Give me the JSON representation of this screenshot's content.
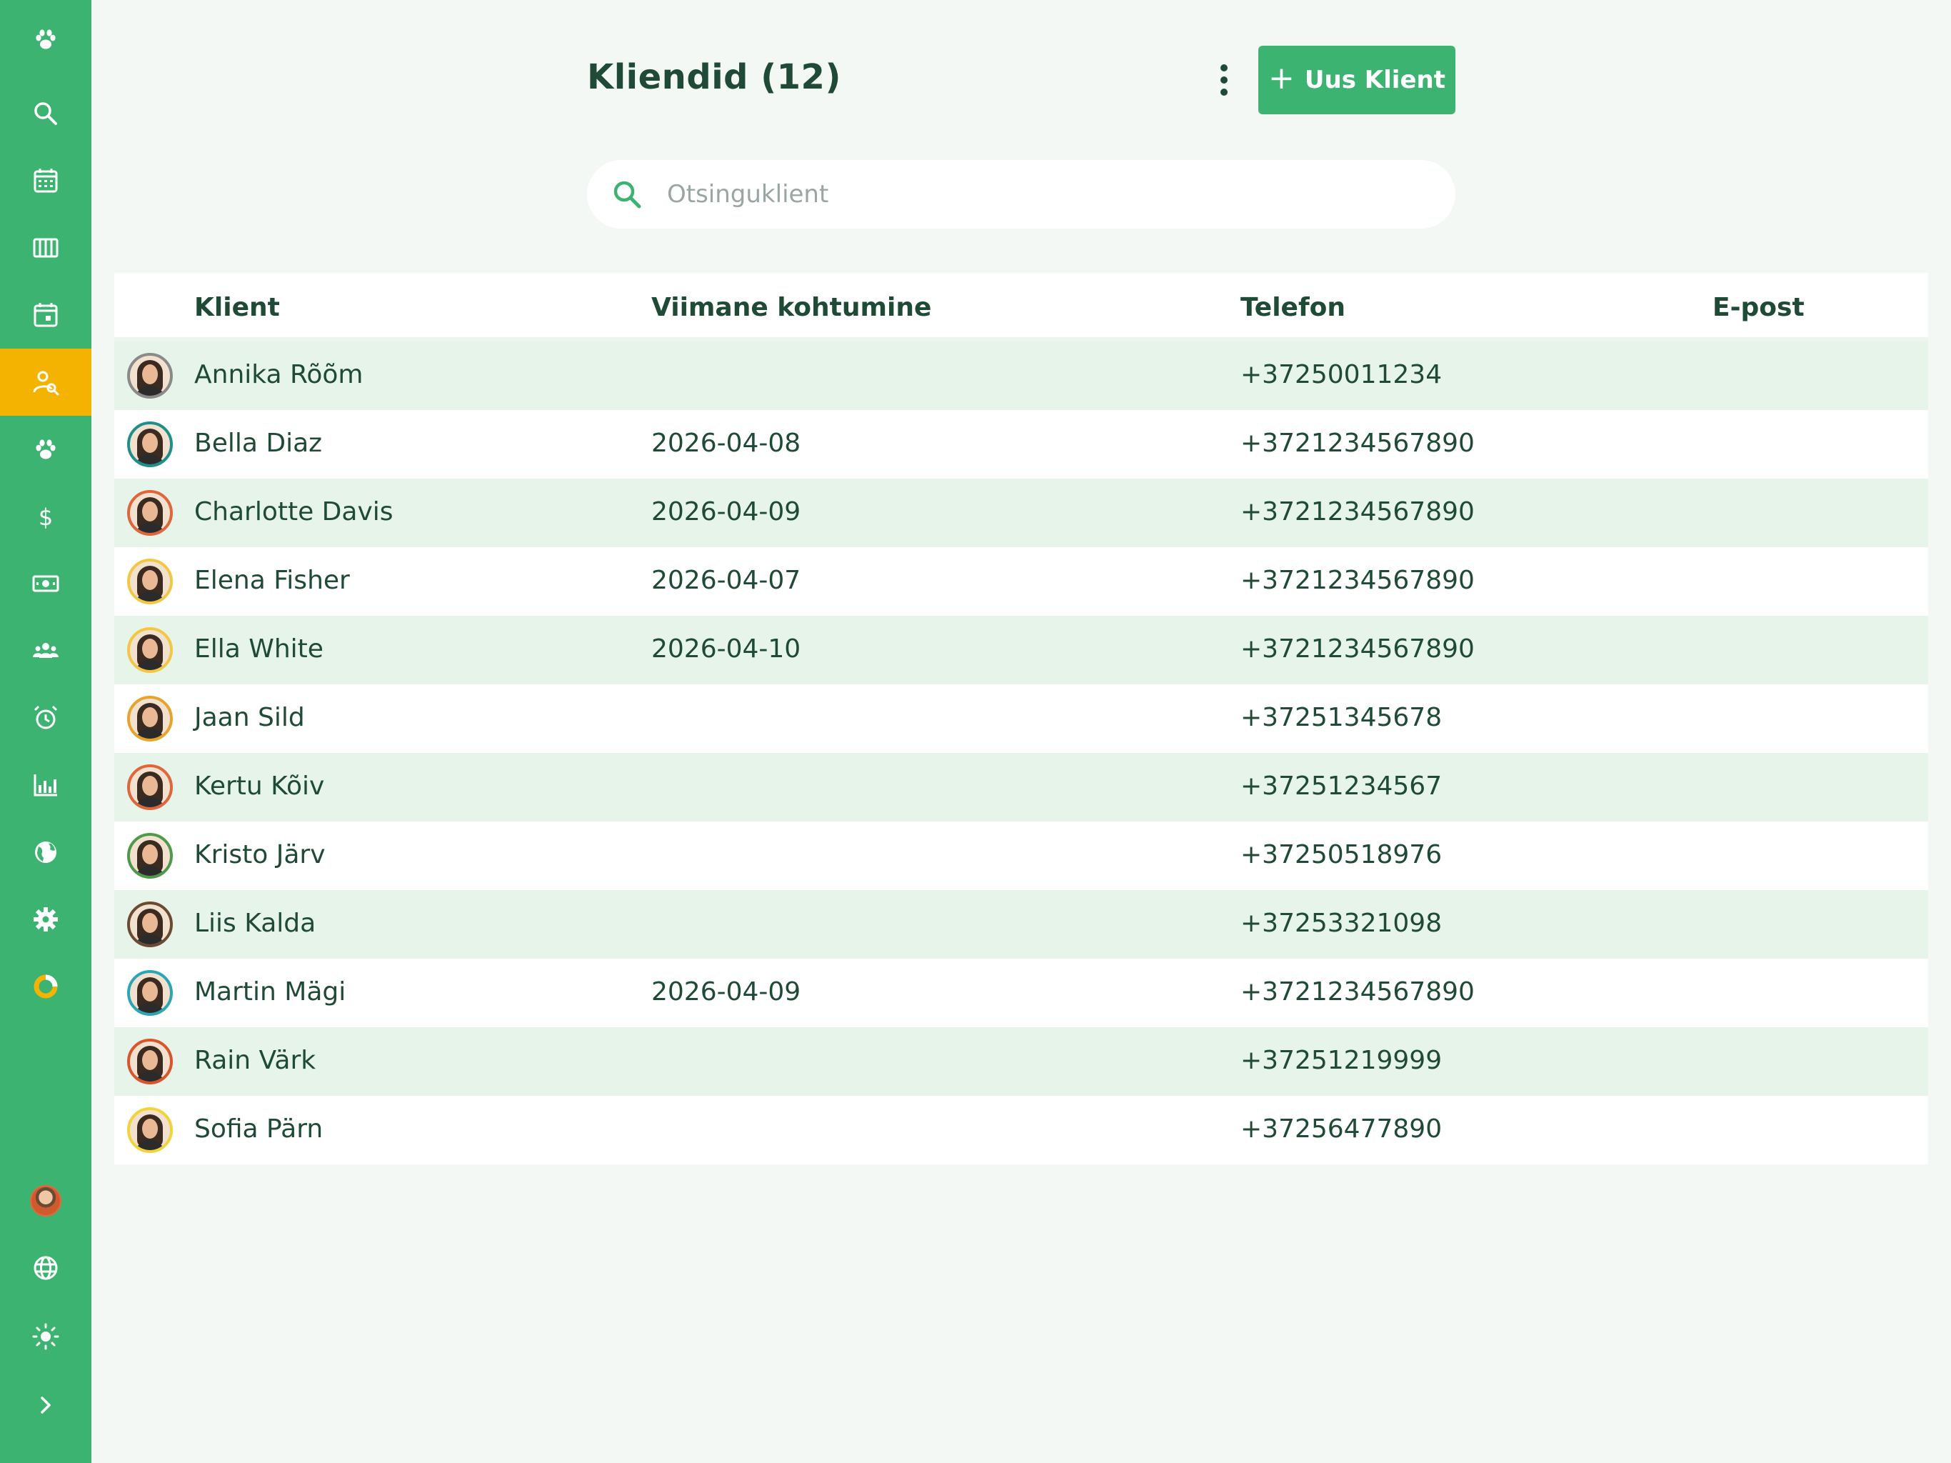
{
  "sidebar": {
    "items": [
      {
        "name": "paw-logo",
        "icon": "paw-icon"
      },
      {
        "name": "search",
        "icon": "search-icon"
      },
      {
        "name": "calendar",
        "icon": "calendar-grid-icon"
      },
      {
        "name": "columns",
        "icon": "columns-icon"
      },
      {
        "name": "calendar-event",
        "icon": "calendar-event-icon"
      },
      {
        "name": "clients",
        "icon": "user-search-icon",
        "active": true
      },
      {
        "name": "pets",
        "icon": "paw-icon"
      },
      {
        "name": "payments",
        "icon": "dollar-icon"
      },
      {
        "name": "cash",
        "icon": "cash-icon"
      },
      {
        "name": "team",
        "icon": "users-icon"
      },
      {
        "name": "reminders",
        "icon": "alarm-icon"
      },
      {
        "name": "reports",
        "icon": "bar-chart-icon"
      },
      {
        "name": "web",
        "icon": "globe-icon"
      },
      {
        "name": "settings",
        "icon": "gear-icon"
      },
      {
        "name": "status",
        "icon": "donut-icon"
      }
    ],
    "bottom": [
      {
        "name": "user-avatar",
        "icon": "avatar"
      },
      {
        "name": "language",
        "icon": "globe-outline-icon"
      },
      {
        "name": "theme",
        "icon": "sun-icon"
      },
      {
        "name": "expand",
        "icon": "chevron-right-icon"
      }
    ]
  },
  "header": {
    "title": "Kliendid (12)",
    "new_button_label": "Uus Klient",
    "new_button_icon": "+"
  },
  "search": {
    "placeholder": "Otsinguklient",
    "value": ""
  },
  "table": {
    "columns": [
      "Klient",
      "Viimane kohtumine",
      "Telefon",
      "E-post"
    ],
    "rows": [
      {
        "name": "Annika Rõõm",
        "last_meeting": "",
        "phone": "+37250011234",
        "email": "",
        "ring": "#8a8a8a"
      },
      {
        "name": "Bella Diaz",
        "last_meeting": "2026-04-08",
        "phone": "+3721234567890",
        "email": "",
        "ring": "#1f8f8a"
      },
      {
        "name": "Charlotte Davis",
        "last_meeting": "2026-04-09",
        "phone": "+3721234567890",
        "email": "",
        "ring": "#e0653a"
      },
      {
        "name": "Elena Fisher",
        "last_meeting": "2026-04-07",
        "phone": "+3721234567890",
        "email": "",
        "ring": "#f2c744"
      },
      {
        "name": "Ella White",
        "last_meeting": "2026-04-10",
        "phone": "+3721234567890",
        "email": "",
        "ring": "#f2c744"
      },
      {
        "name": "Jaan Sild",
        "last_meeting": "",
        "phone": "+37251345678",
        "email": "",
        "ring": "#e8a32a"
      },
      {
        "name": "Kertu Kõiv",
        "last_meeting": "",
        "phone": "+37251234567",
        "email": "",
        "ring": "#e0653a"
      },
      {
        "name": "Kristo Järv",
        "last_meeting": "",
        "phone": "+37250518976",
        "email": "",
        "ring": "#4f9a4a"
      },
      {
        "name": "Liis Kalda",
        "last_meeting": "",
        "phone": "+37253321098",
        "email": "",
        "ring": "#6b4a33"
      },
      {
        "name": "Martin Mägi",
        "last_meeting": "2026-04-09",
        "phone": "+3721234567890",
        "email": "",
        "ring": "#2aa7b3"
      },
      {
        "name": "Rain Värk",
        "last_meeting": "",
        "phone": "+37251219999",
        "email": "",
        "ring": "#d9552b"
      },
      {
        "name": "Sofia Pärn",
        "last_meeting": "",
        "phone": "+37256477890",
        "email": "",
        "ring": "#f2d33a"
      }
    ]
  },
  "colors": {
    "sidebar": "#3cb371",
    "active": "#f5b301",
    "text": "#1f4a35",
    "row_alt": "#e6f4ea",
    "background": "#f3f8f4"
  }
}
